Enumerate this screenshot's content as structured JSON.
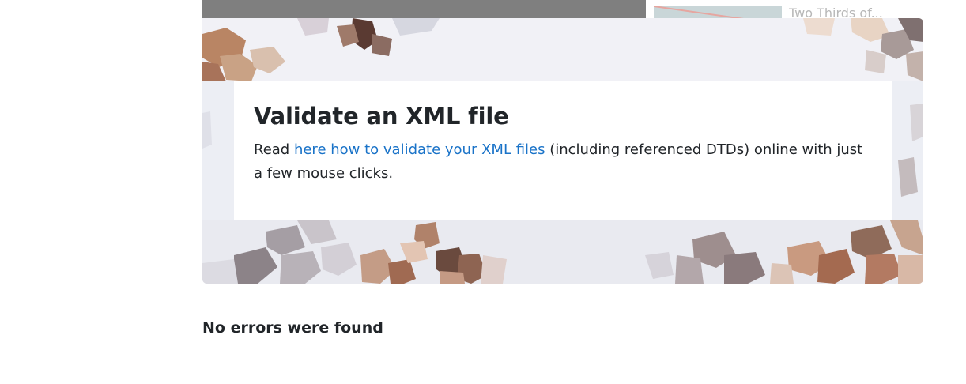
{
  "related": {
    "title": "Two Thirds of..."
  },
  "hero": {
    "title": "Validate an XML file",
    "text_before": "Read ",
    "link_text": "here how to validate your XML files",
    "text_after": " (including referenced DTDs) online with just a few mouse clicks."
  },
  "result": {
    "message": "No errors were found"
  },
  "colors": {
    "link": "#1a73c8",
    "text": "#212529",
    "top_bar": "#7f7f7f"
  }
}
